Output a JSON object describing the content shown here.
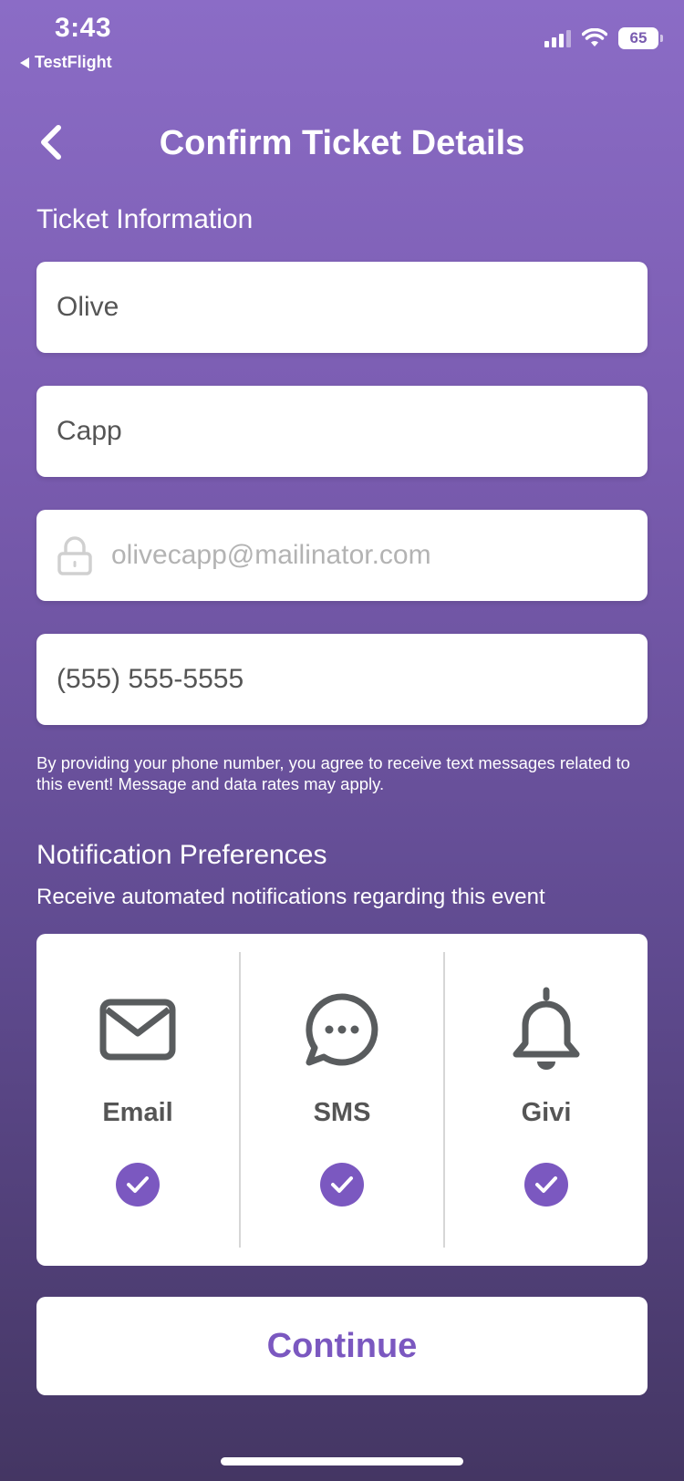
{
  "status_bar": {
    "time": "3:43",
    "back_app": "TestFlight",
    "battery": "65"
  },
  "nav": {
    "title": "Confirm Ticket Details"
  },
  "ticket_info": {
    "heading": "Ticket Information",
    "first_name": "Olive",
    "last_name": "Capp",
    "email": "olivecapp@mailinator.com",
    "phone": "(555) 555-5555",
    "disclaimer": "By providing your phone number, you agree to receive text messages related to this event! Message and data rates may apply."
  },
  "notifications": {
    "heading": "Notification Preferences",
    "subheading": "Receive automated notifications regarding this event",
    "options": [
      {
        "label": "Email",
        "icon": "envelope-icon",
        "checked": true
      },
      {
        "label": "SMS",
        "icon": "chat-bubble-icon",
        "checked": true
      },
      {
        "label": "Givi",
        "icon": "bell-icon",
        "checked": true
      }
    ]
  },
  "continue_label": "Continue",
  "colors": {
    "accent": "#7b58c0",
    "gradient_top": "#8b6cc6",
    "gradient_bottom": "#443663"
  }
}
